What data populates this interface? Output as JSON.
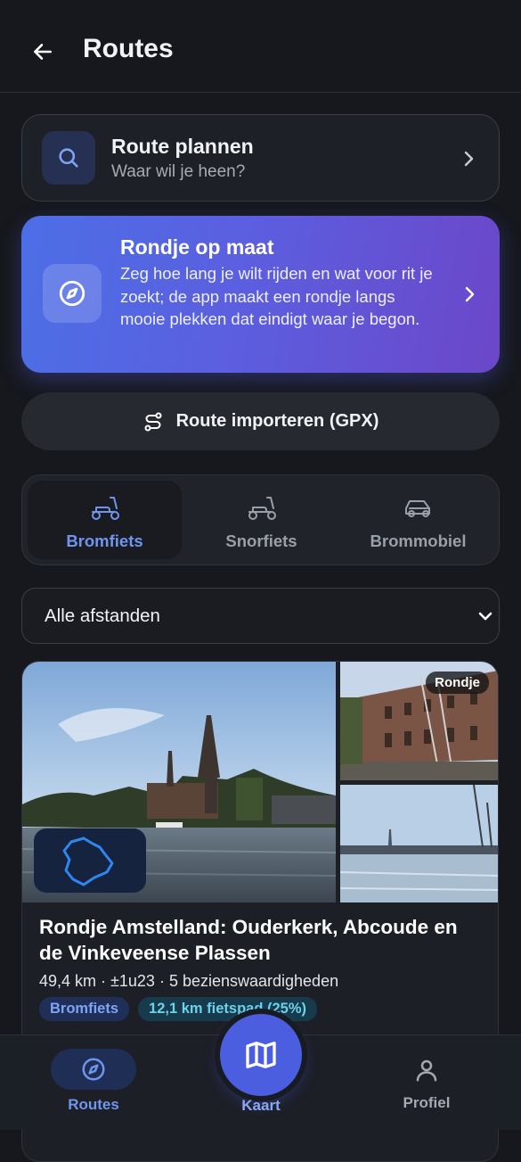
{
  "header": {
    "title": "Routes"
  },
  "plan": {
    "title": "Route plannen",
    "subtitle": "Waar wil je heen?"
  },
  "custom_loop": {
    "title": "Rondje op maat",
    "description": "Zeg hoe lang je wilt rijden en wat voor rit je zoekt; de app maakt een rondje langs mooie plekken dat eindigt waar je begon."
  },
  "import": {
    "label": "Route importeren (GPX)"
  },
  "vehicles": [
    {
      "label": "Bromfiets",
      "icon": "scooter-icon",
      "active": true
    },
    {
      "label": "Snorfiets",
      "icon": "scooter-icon",
      "active": false
    },
    {
      "label": "Brommobiel",
      "icon": "car-icon",
      "active": false
    }
  ],
  "filter": {
    "selected": "Alle afstanden"
  },
  "route_card": {
    "badge": "Rondje",
    "name": "Rondje Amstelland: Ouderkerk, Abcoude en de Vinkeveense Plassen",
    "meta": "49,4 km · ±1u23 · 5 bezienswaardigheden",
    "tags": [
      "Bromfiets",
      "12,1 km fietspad (25%)"
    ]
  },
  "bottom_nav": {
    "routes": "Routes",
    "map": "Kaart",
    "profile": "Profiel"
  },
  "colors": {
    "accent": "#4b5ee0",
    "background": "#16181d",
    "active_text": "#6f95ee"
  }
}
